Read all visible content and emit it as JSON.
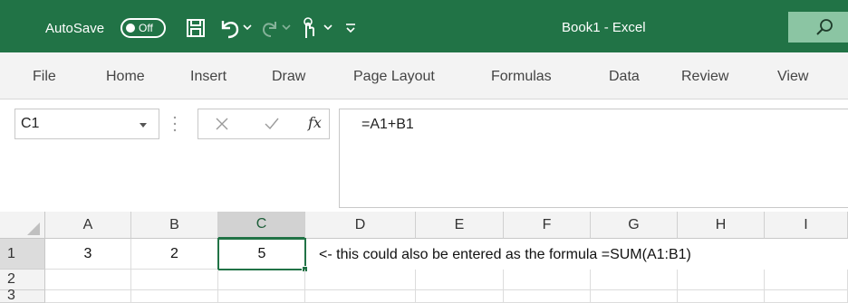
{
  "titlebar": {
    "autosave_label": "AutoSave",
    "autosave_state": "Off",
    "document_title": "Book1 - Excel"
  },
  "tabs": [
    "File",
    "Home",
    "Insert",
    "Draw",
    "Page Layout",
    "Formulas",
    "Data",
    "Review",
    "View"
  ],
  "formula_bar": {
    "name_box": "C1",
    "fx_label": "fx",
    "formula": "=A1+B1"
  },
  "grid": {
    "columns": [
      "A",
      "B",
      "C",
      "D",
      "E",
      "F",
      "G",
      "H",
      "I"
    ],
    "selected_column": "C",
    "rows": [
      "1",
      "2",
      "3"
    ],
    "row1": {
      "A": "3",
      "B": "2",
      "C": "5"
    },
    "note": "<- this could also be entered as the formula =SUM(A1:B1)"
  },
  "colors": {
    "excel_green": "#217346",
    "search_box": "#8bc5a3",
    "ribbon_bg": "#f3f3f3"
  },
  "icons": {
    "save": "save-icon",
    "undo": "undo-icon",
    "redo": "redo-icon",
    "touch_mode": "touch-mode-icon",
    "search": "search-icon"
  }
}
